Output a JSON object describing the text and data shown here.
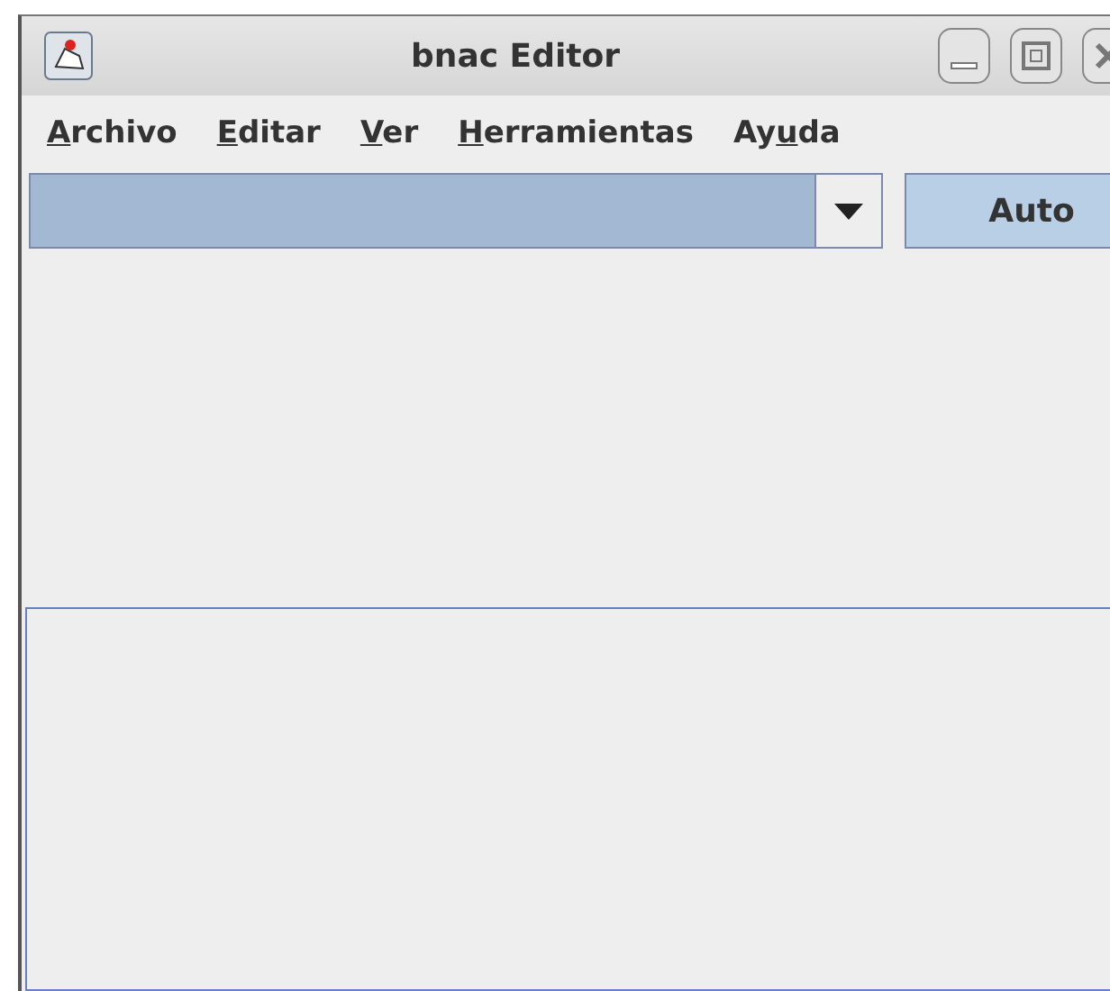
{
  "window": {
    "title": "bnac Editor"
  },
  "menu": [
    {
      "underlined": "A",
      "after": "rchivo"
    },
    {
      "underlined": "E",
      "after": "ditar"
    },
    {
      "underlined": "V",
      "after": "er"
    },
    {
      "underlined": "H",
      "after": "erramientas"
    },
    {
      "before": "Ay",
      "underlined": "u",
      "after": "da"
    }
  ],
  "toolbar": {
    "button": "Auto"
  }
}
